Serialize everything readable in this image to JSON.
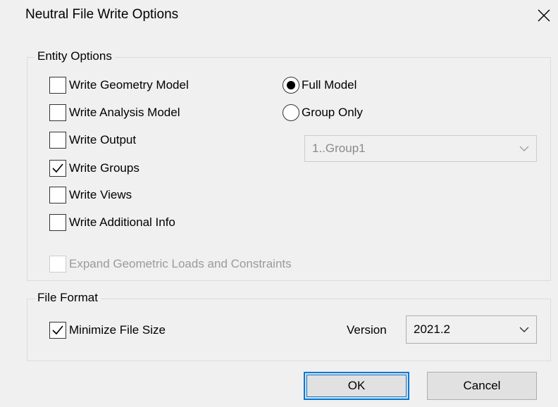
{
  "window": {
    "title": "Neutral File Write Options",
    "close_icon": "close-icon"
  },
  "entity_options": {
    "label": "Entity Options",
    "checkboxes": [
      {
        "label": "Write Geometry Model",
        "checked": false
      },
      {
        "label": "Write Analysis Model",
        "checked": false
      },
      {
        "label": "Write Output",
        "checked": false
      },
      {
        "label": "Write Groups",
        "checked": true
      },
      {
        "label": "Write Views",
        "checked": false
      },
      {
        "label": "Write Additional Info",
        "checked": false
      }
    ],
    "radios": [
      {
        "label": "Full Model",
        "selected": true
      },
      {
        "label": "Group Only",
        "selected": false
      }
    ],
    "group_select": {
      "value": "1..Group1",
      "enabled": false
    },
    "expand": {
      "label": "Expand Geometric Loads and Constraints",
      "checked": false,
      "enabled": false
    }
  },
  "file_format": {
    "label": "File Format",
    "minimize": {
      "label": "Minimize File Size",
      "checked": true
    },
    "version_label": "Version",
    "version_value": "2021.2"
  },
  "buttons": {
    "ok": "OK",
    "cancel": "Cancel"
  },
  "colors": {
    "background": "#f0f0f0",
    "default_button_border": "#0078d7",
    "disabled_text": "#9a9a9a"
  }
}
